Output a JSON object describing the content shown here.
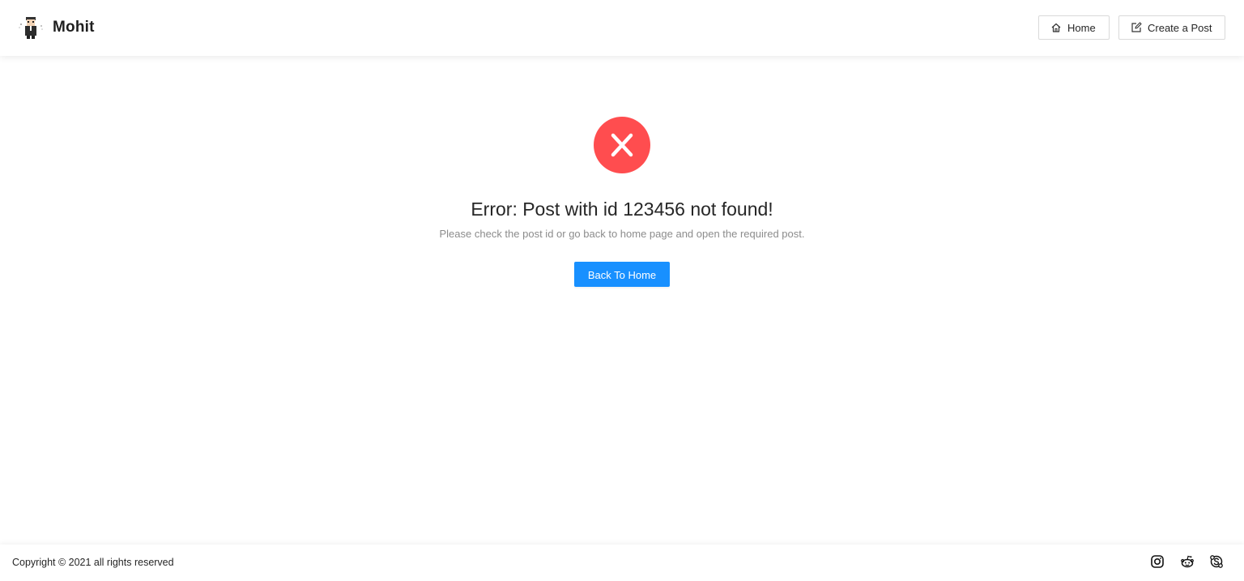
{
  "header": {
    "brand_name": "Mohit",
    "avatar_icon": "cartoon-avatar-icon",
    "nav": {
      "home_label": "Home",
      "home_icon": "home-icon",
      "create_label": "Create a Post",
      "create_icon": "edit-icon"
    }
  },
  "main": {
    "status_icon": "close-circle-icon",
    "status_color": "#ff4d4f",
    "title": "Error: Post with id 123456 not found!",
    "subtitle": "Please check the post id or go back to home page and open the required post.",
    "back_button_label": "Back To Home",
    "accent_color": "#1890ff"
  },
  "footer": {
    "copyright": "Copyright © 2021 all rights reserved",
    "social_icons": [
      "instagram-icon",
      "reddit-icon",
      "skype-icon"
    ]
  }
}
